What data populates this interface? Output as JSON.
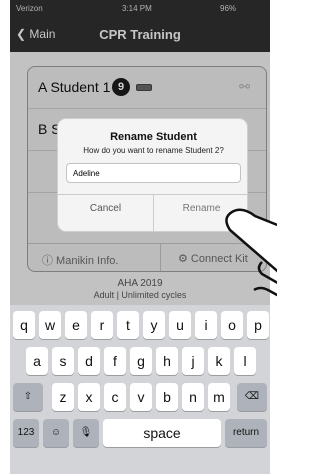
{
  "status_bar": {
    "carrier": "Verizon",
    "time": "3:14 PM",
    "battery": "96%"
  },
  "nav": {
    "back_label": "Main",
    "title": "CPR Training"
  },
  "students": [
    {
      "label": "A Student 1",
      "number": "9"
    },
    {
      "label": "B S",
      "number": ""
    }
  ],
  "footer": {
    "manikin_info": "ⓘ Manikin Info.",
    "connect_kit": "⚙ Connect Kit"
  },
  "mode": {
    "line1": "AHA 2019",
    "line2": "Adult | Unlimited cycles"
  },
  "alert": {
    "title": "Rename Student",
    "message": "How do you want to rename Student 2?",
    "input_value": "Adeline",
    "cancel_label": "Cancel",
    "rename_label": "Rename"
  },
  "keyboard": {
    "row1": [
      "q",
      "w",
      "e",
      "r",
      "t",
      "y",
      "u",
      "i",
      "o",
      "p"
    ],
    "row2": [
      "a",
      "s",
      "d",
      "f",
      "g",
      "h",
      "j",
      "k",
      "l"
    ],
    "row3": [
      "z",
      "x",
      "c",
      "v",
      "b",
      "n",
      "m"
    ],
    "shift_glyph": "⇧",
    "delete_glyph": "⌫",
    "numbers_label": "123",
    "emoji_glyph": "☺",
    "mic_glyph": "🎙",
    "space_label": "space",
    "return_label": "return"
  }
}
